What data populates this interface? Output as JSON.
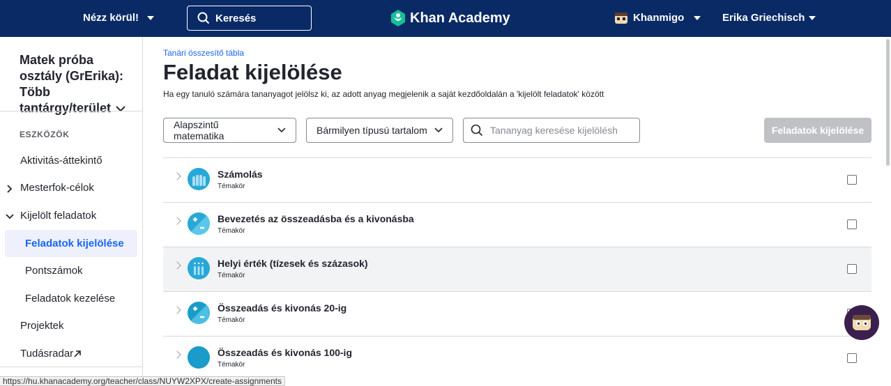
{
  "topbar": {
    "explore_label": "Nézz körül!",
    "search_label": "Keresés",
    "logo_text": "Khan Academy",
    "khanmigo_label": "Khanmigo",
    "user_name": "Erika Griechisch",
    "bg_color": "#0a2a66"
  },
  "sidebar": {
    "class_title": "Matek próba osztály (GrErika): Több tantárgy/terület",
    "section_label": "ESZKÖZÖK",
    "items": [
      {
        "label": "Aktivitás-áttekintő"
      },
      {
        "label": "Mesterfok-célok"
      },
      {
        "label": "Kijelölt feladatok"
      },
      {
        "label": "Feladatok kijelölése"
      },
      {
        "label": "Pontszámok"
      },
      {
        "label": "Feladatok kezelése"
      },
      {
        "label": "Projektek"
      },
      {
        "label": "Tudásradar"
      }
    ]
  },
  "main": {
    "breadcrumb": "Tanári összesítő tábla",
    "title": "Feladat kijelölése",
    "subtitle": "Ha egy tanuló számára tananyagot jelölsz ki, az adott anyag megjelenik a saját kezdőoldalán a 'kijelölt feladatok' között",
    "subject_dropdown": "Alapszintű matematika",
    "content_type_dropdown": "Bármilyen típusú tartalom",
    "search_placeholder": "Tananyag keresése kijelölésh",
    "assign_button": "Feladatok kijelölése",
    "accent_color": "#1865f2",
    "rows": [
      {
        "title": "Számolás",
        "type": "Témakör"
      },
      {
        "title": "Bevezetés az összeadásba és a kivonásba",
        "type": "Témakör"
      },
      {
        "title": "Helyi érték (tízesek és százasok)",
        "type": "Témakör"
      },
      {
        "title": "Összeadás és kivonás 20-ig",
        "type": "Témakör"
      },
      {
        "title": "Összeadás és kivonás 100-ig",
        "type": "Témakör"
      }
    ]
  },
  "statusbar": {
    "url": "https://hu.khanacademy.org/teacher/class/NUYW2XPX/create-assignments"
  }
}
